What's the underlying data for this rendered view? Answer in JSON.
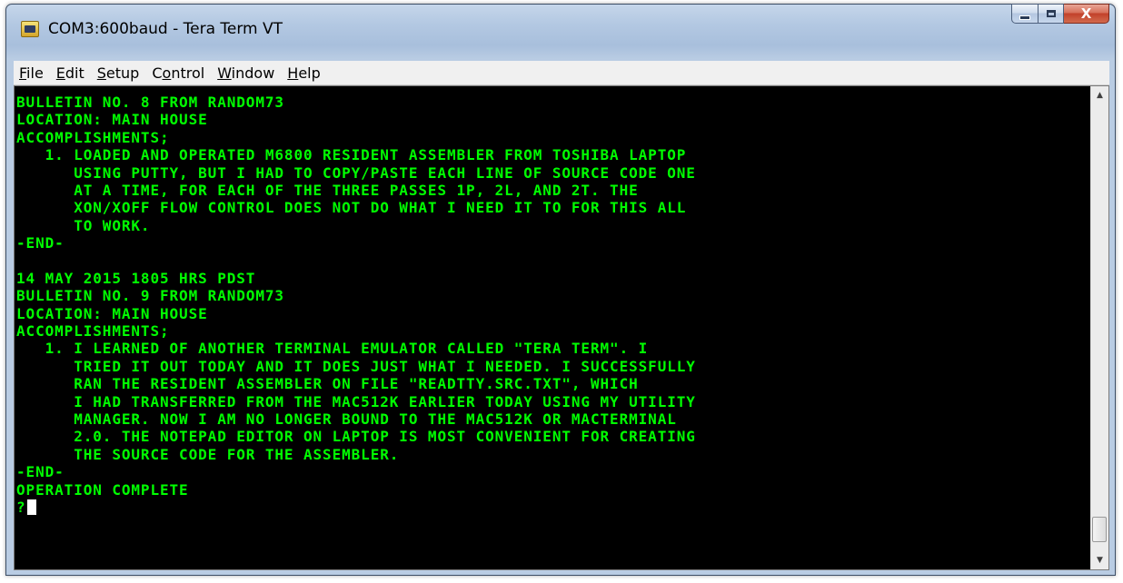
{
  "window": {
    "title": "COM3:600baud - Tera Term VT",
    "icon": "tera-term-app-icon",
    "caption_buttons": {
      "minimize_icon": "minimize-icon",
      "maximize_icon": "maximize-icon",
      "close_label": "X"
    }
  },
  "menubar": {
    "items": [
      {
        "label": "File",
        "key": "F",
        "rest": "ile"
      },
      {
        "label": "Edit",
        "key": "E",
        "rest": "dit"
      },
      {
        "label": "Setup",
        "key": "S",
        "rest": "etup"
      },
      {
        "label": "Control",
        "key": "",
        "pre": "C",
        "keyc": "o",
        "rest": "ntrol"
      },
      {
        "label": "Window",
        "key": "W",
        "rest": "indow"
      },
      {
        "label": "Help",
        "key": "H",
        "rest": "elp"
      }
    ]
  },
  "terminal": {
    "lines": [
      "BULLETIN NO. 8 FROM RANDOM73",
      "LOCATION: MAIN HOUSE",
      "ACCOMPLISHMENTS;",
      "   1. LOADED AND OPERATED M6800 RESIDENT ASSEMBLER FROM TOSHIBA LAPTOP",
      "      USING PUTTY, BUT I HAD TO COPY/PASTE EACH LINE OF SOURCE CODE ONE",
      "      AT A TIME, FOR EACH OF THE THREE PASSES 1P, 2L, AND 2T. THE",
      "      XON/XOFF FLOW CONTROL DOES NOT DO WHAT I NEED IT TO FOR THIS ALL",
      "      TO WORK.",
      "-END-",
      "",
      "14 MAY 2015 1805 HRS PDST",
      "BULLETIN NO. 9 FROM RANDOM73",
      "LOCATION: MAIN HOUSE",
      "ACCOMPLISHMENTS;",
      "   1. I LEARNED OF ANOTHER TERMINAL EMULATOR CALLED \"TERA TERM\". I",
      "      TRIED IT OUT TODAY AND IT DOES JUST WHAT I NEEDED. I SUCCESSFULLY",
      "      RAN THE RESIDENT ASSEMBLER ON FILE \"READTTY.SRC.TXT\", WHICH",
      "      I HAD TRANSFERRED FROM THE MAC512K EARLIER TODAY USING MY UTILITY",
      "      MANAGER. NOW I AM NO LONGER BOUND TO THE MAC512K OR MACTERMINAL",
      "      2.0. THE NOTEPAD EDITOR ON LAPTOP IS MOST CONVENIENT FOR CREATING",
      "      THE SOURCE CODE FOR THE ASSEMBLER.",
      "-END-",
      "OPERATION COMPLETE"
    ],
    "prompt": "?",
    "text_color": "#00ff00",
    "background_color": "#000000"
  },
  "scrollbar": {
    "up_icon": "scroll-up-arrow-icon",
    "down_icon": "scroll-down-arrow-icon",
    "position_fraction": 0.97
  }
}
